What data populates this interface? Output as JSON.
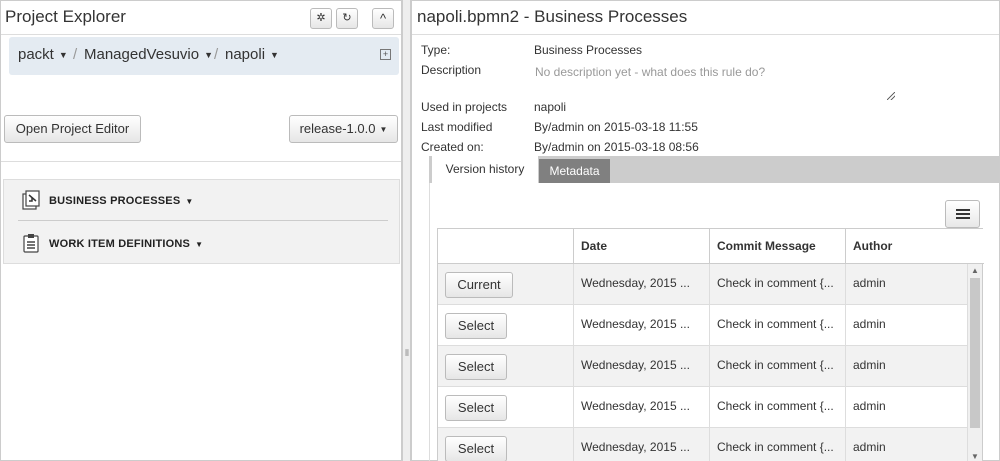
{
  "left_panel": {
    "title": "Project Explorer",
    "header_buttons": [
      {
        "icon": "gear-icon",
        "glyph": "✲"
      },
      {
        "icon": "refresh-icon",
        "glyph": "↻"
      },
      {
        "icon": "chevron-up-icon",
        "glyph": "^"
      }
    ],
    "breadcrumb": {
      "items": [
        {
          "label": "packt"
        },
        {
          "label": "ManagedVesuvio"
        },
        {
          "label": "napoli"
        }
      ],
      "separator": "/",
      "expand_glyph": "+"
    },
    "open_project_editor_label": "Open Project Editor",
    "branch_select": "release-1.0.0",
    "asset_groups": [
      {
        "label": "BUSINESS PROCESSES",
        "icon": "business-process-icon"
      },
      {
        "label": "WORK ITEM DEFINITIONS",
        "icon": "work-item-icon"
      }
    ]
  },
  "splitter_glyph": "⦀",
  "right_panel": {
    "title": "napoli.bpmn2 - Business Processes",
    "properties": {
      "type_label": "Type:",
      "type_value": "Business Processes",
      "description_label": "Description",
      "description_placeholder": "No description yet - what does this rule do?",
      "used_in_label": "Used in projects",
      "used_in_value": "napoli",
      "last_modified_label": "Last modified",
      "last_modified_value": "By/admin on 2015-03-18 11:55",
      "created_on_label": "Created on:",
      "created_on_value": "By/admin on 2015-03-18 08:56"
    },
    "tabs": [
      {
        "label": "Version history",
        "active": true
      },
      {
        "label": "Metadata",
        "active": false
      }
    ],
    "history_table": {
      "columns": [
        "",
        "Date",
        "Commit Message",
        "Author"
      ],
      "rows": [
        {
          "action": "Current",
          "date": "Wednesday, 2015 ...",
          "message": "Check in comment {...",
          "author": "admin"
        },
        {
          "action": "Select",
          "date": "Wednesday, 2015 ...",
          "message": "Check in comment {...",
          "author": "admin"
        },
        {
          "action": "Select",
          "date": "Wednesday, 2015 ...",
          "message": "Check in comment {...",
          "author": "admin"
        },
        {
          "action": "Select",
          "date": "Wednesday, 2015 ...",
          "message": "Check in comment {...",
          "author": "admin"
        },
        {
          "action": "Select",
          "date": "Wednesday, 2015 ...",
          "message": "Check in comment {...",
          "author": "admin"
        }
      ]
    }
  },
  "colors": {
    "breadcrumb_bg": "#e4ebf2",
    "tab_bar_bg": "#cccccc",
    "tab_inactive_bg": "#808080",
    "asset_panel_bg": "#f2f2f2"
  }
}
